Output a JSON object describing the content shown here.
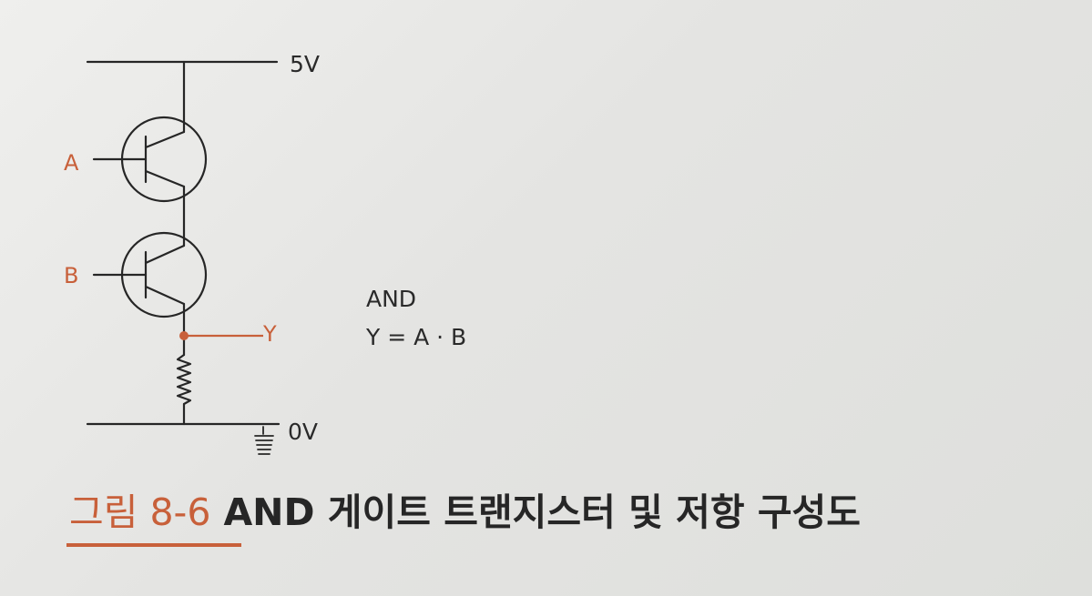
{
  "labels": {
    "supply": "5V",
    "ground": "0V",
    "input_a": "A",
    "input_b": "B",
    "output": "Y",
    "gate_name": "AND",
    "expression": "Y = A · B"
  },
  "caption": {
    "number": "그림 8-6",
    "text": "AND 게이트 트랜지스터 및 저항 구성도"
  },
  "colors": {
    "accent": "#c8603a",
    "ink": "#262626"
  }
}
